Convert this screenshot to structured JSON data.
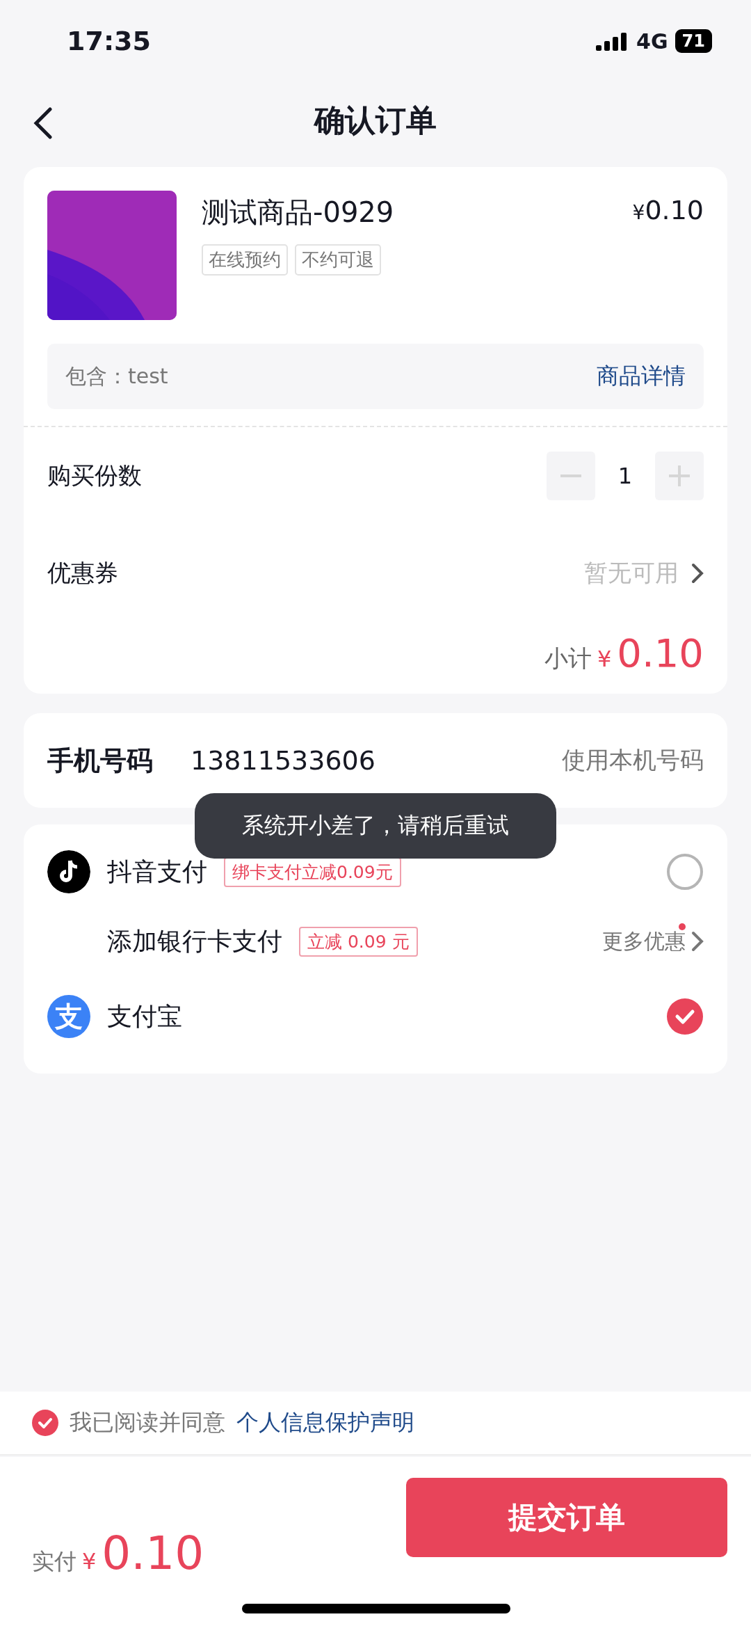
{
  "status_bar": {
    "time": "17:35",
    "network": "4G",
    "battery": "71"
  },
  "header": {
    "title": "确认订单"
  },
  "product": {
    "name": "测试商品-0929",
    "currency": "¥",
    "price": "0.10",
    "tags": [
      "在线预约",
      "不约可退"
    ],
    "includes": "包含：test",
    "details_link": "商品详情"
  },
  "quantity": {
    "label": "购买份数",
    "value": "1"
  },
  "coupon": {
    "label": "优惠券",
    "value": "暂无可用"
  },
  "subtotal": {
    "label": "小计",
    "currency": "¥",
    "amount": "0.10"
  },
  "phone": {
    "label": "手机号码",
    "number": "13811533606",
    "action": "使用本机号码"
  },
  "payments": [
    {
      "kind": "douyin",
      "name": "抖音支付",
      "promo": "绑卡支付立减0.09元",
      "selected": false
    },
    {
      "kind": "bank_card",
      "name": "添加银行卡支付",
      "promo": "立减 0.09 元",
      "more": "更多优惠"
    },
    {
      "kind": "alipay",
      "logo_char": "支",
      "name": "支付宝",
      "selected": true
    }
  ],
  "agreement": {
    "checked": true,
    "text": "我已阅读并同意",
    "link": "个人信息保护声明"
  },
  "footer": {
    "label": "实付",
    "currency": "¥",
    "amount": "0.10",
    "submit": "提交订单"
  },
  "toast": {
    "text": "系统开小差了，请稍后重试"
  }
}
